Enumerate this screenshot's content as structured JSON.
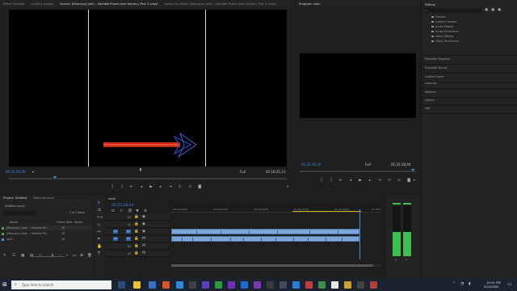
{
  "source": {
    "tabs": [
      "Effect Controls",
      "Lumetri Scopes",
      "Source: [Mascaux] (eel) – Horrible Phone Jane Games | Part 2.1mp4",
      "Audio Clip Mixer: [Mascaux] (eel) – Horrible Phone Jane Games | Part 2.1mp4"
    ],
    "timecode": "00;35;39;36",
    "fit": "Full",
    "duration": "02;18;31;21"
  },
  "program": {
    "title": "Program: main",
    "timecode": "01;22;18;44",
    "fit": "Full",
    "duration": "01;22;18;44"
  },
  "effects": {
    "title": "Effects",
    "folders": [
      "Presets",
      "Lumetri Presets",
      "Audio Effects",
      "Audio Transitions",
      "Video Effects",
      "Video Transitions"
    ],
    "sections": [
      "Essential Graphics",
      "Essential Sound",
      "Lumetri Color",
      "Libraries",
      "Markers",
      "History",
      "Info"
    ]
  },
  "project": {
    "tabs": [
      "Project: Untitled",
      "Media Browser"
    ],
    "file": "Untitled.prproj",
    "count": "1 of 3 items",
    "col_name": "Name",
    "col_fps": "Frame Rate",
    "col_media": "Media",
    "items": [
      {
        "name": "[Mascaux] (eel) – Horrible Ph…",
        "fps": "30",
        "color": "#4fa04a"
      },
      {
        "name": "[Mascaux] (eel) – Horrible Ph…",
        "fps": "30",
        "color": "#4fa04a"
      },
      {
        "name": "main",
        "fps": "30",
        "color": "#5a8fd6"
      }
    ]
  },
  "timeline": {
    "tab": "main",
    "timecode": "01;22;18;44",
    "ruler": [
      "00;00;00;00",
      "00;20;00;00",
      "00;40;00;00",
      "01;00;00;00",
      "01;20;00;00",
      "01;40;0"
    ],
    "tracks": [
      "V3",
      "V2",
      "V1",
      "A1",
      "A2",
      "A3"
    ],
    "track_targets": [
      "V1",
      "A1"
    ]
  },
  "taskbar": {
    "search_placeholder": "Type here to search",
    "time": "10:01 PM",
    "date": "9/22/2020"
  },
  "colors": {
    "accent": "#3c86e0",
    "clip": "#7da6d6",
    "meter": "#3fbf4f",
    "arrow": "#cc2b1a"
  }
}
